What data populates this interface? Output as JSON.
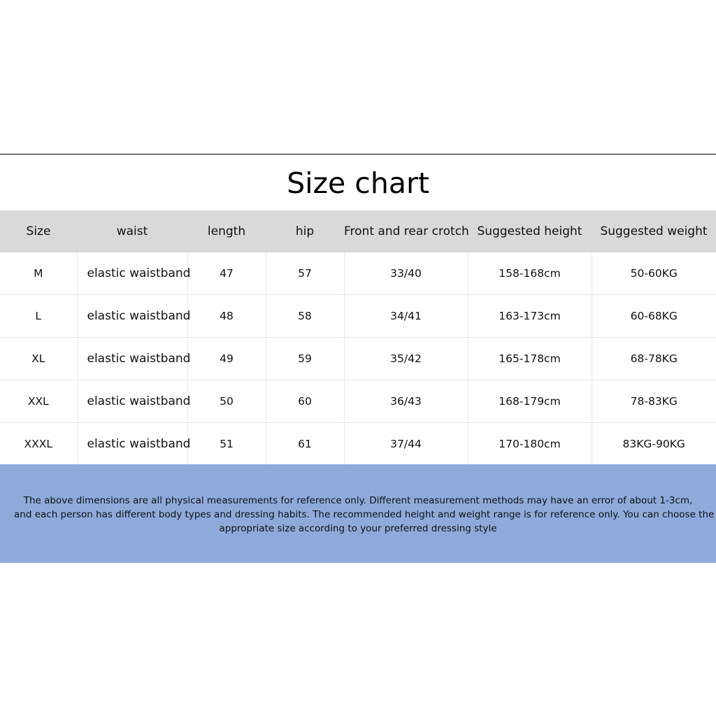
{
  "title": "Size chart",
  "table": {
    "headers": [
      "Size",
      "waist",
      "length",
      "hip",
      "Front and rear crotch",
      "Suggested height",
      "Suggested weight"
    ],
    "rows": [
      [
        "M",
        "elastic waistband",
        "47",
        "57",
        "33/40",
        "158-168cm",
        "50-60KG"
      ],
      [
        "L",
        "elastic waistband",
        "48",
        "58",
        "34/41",
        "163-173cm",
        "60-68KG"
      ],
      [
        "XL",
        "elastic waistband",
        "49",
        "59",
        "35/42",
        "165-178cm",
        "68-78KG"
      ],
      [
        "XXL",
        "elastic waistband",
        "50",
        "60",
        "36/43",
        "168-179cm",
        "78-83KG"
      ],
      [
        "XXXL",
        "elastic waistband",
        "51",
        "61",
        "37/44",
        "170-180cm",
        "83KG-90KG"
      ]
    ]
  },
  "note": {
    "lines": [
      "The above dimensions are all physical measurements for reference only. Different measurement methods may have an error of about 1-3cm,",
      "and each person has different body types and dressing habits. The recommended height and weight range is for reference only. You can choose the",
      "appropriate size according to your preferred dressing style"
    ]
  },
  "colors": {
    "header_bg": "#d9d9d9",
    "note_bg": "#8eaadb",
    "rule": "#000000"
  }
}
